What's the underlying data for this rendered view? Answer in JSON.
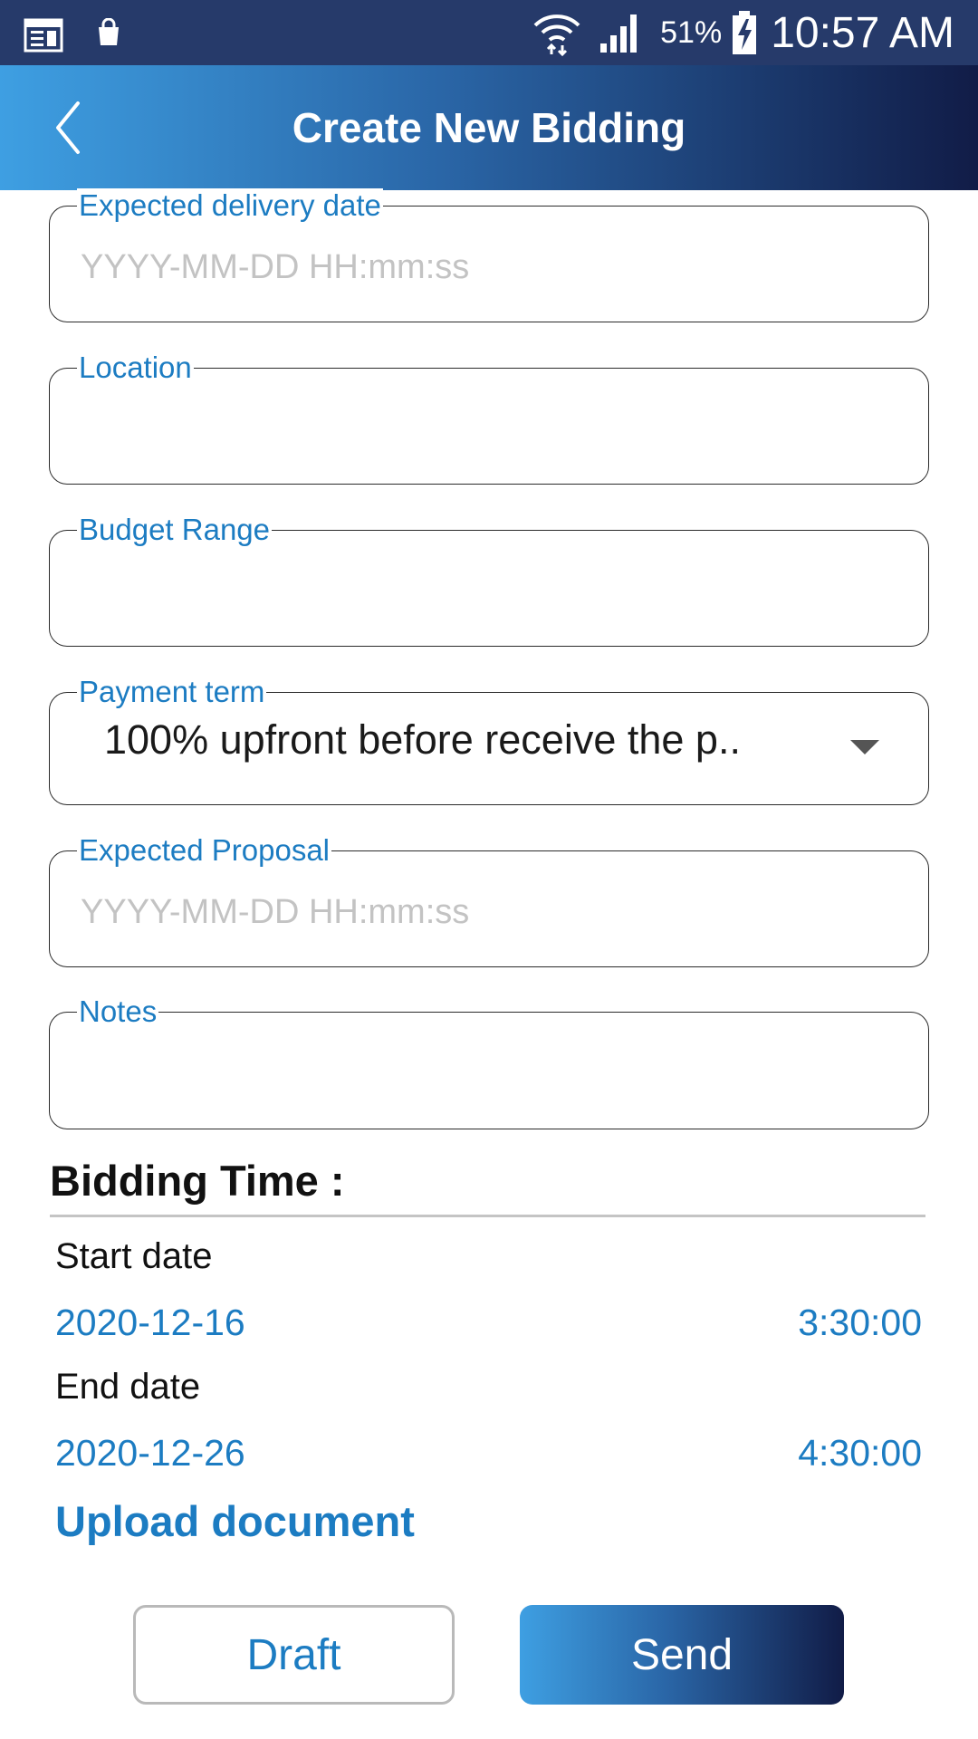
{
  "status_bar": {
    "battery": "51%",
    "time": "10:57 AM",
    "icons": [
      "calendar-icon",
      "shopping-bag-icon",
      "wifi-icon",
      "signal-icon",
      "battery-charging-icon"
    ]
  },
  "header": {
    "title": "Create New Bidding",
    "back_icon": "chevron-left-icon"
  },
  "form": {
    "expected_delivery_date": {
      "label": "Expected delivery date",
      "value": "",
      "placeholder": "YYYY-MM-DD HH:mm:ss"
    },
    "location": {
      "label": "Location",
      "value": "",
      "placeholder": ""
    },
    "budget_range": {
      "label": "Budget Range",
      "value": "",
      "placeholder": ""
    },
    "payment_term": {
      "label": "Payment term",
      "selected": "100% upfront before receive the p.."
    },
    "expected_proposal": {
      "label": "Expected Proposal",
      "value": "",
      "placeholder": "YYYY-MM-DD HH:mm:ss"
    },
    "notes": {
      "label": "Notes",
      "value": "",
      "placeholder": ""
    }
  },
  "bidding_time": {
    "title": "Bidding Time :",
    "start": {
      "label": "Start date",
      "date": "2020-12-16",
      "time": "3:30:00"
    },
    "end": {
      "label": "End date",
      "date": "2020-12-26",
      "time": "4:30:00"
    }
  },
  "upload": {
    "label": "Upload document"
  },
  "actions": {
    "draft_label": "Draft",
    "send_label": "Send"
  },
  "colors": {
    "status_bar": "#263a6a",
    "accent": "#1c7cc2",
    "gradient_start": "#3e9fe2",
    "gradient_end": "#111c47"
  }
}
